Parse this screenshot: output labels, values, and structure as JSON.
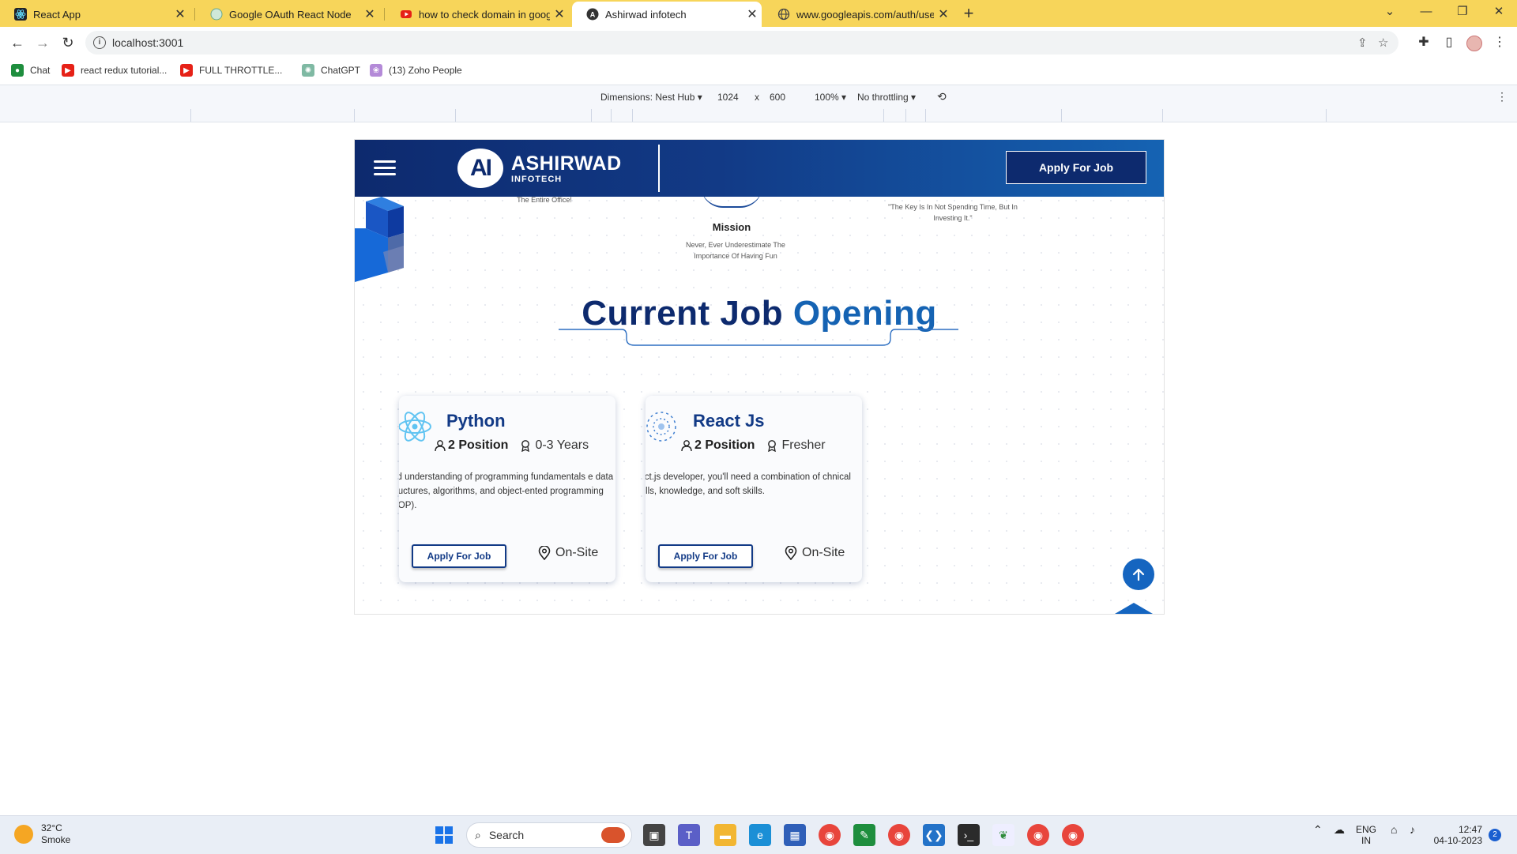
{
  "browser": {
    "tabs": [
      {
        "title": "React App",
        "icon": "react-icon"
      },
      {
        "title": "Google OAuth React Node",
        "icon": "globe-icon"
      },
      {
        "title": "how to check domain in google",
        "icon": "youtube-icon"
      },
      {
        "title": "Ashirwad infotech",
        "icon": "ai-logo-icon"
      },
      {
        "title": "www.googleapis.com/auth/user",
        "icon": "globe-icon"
      }
    ],
    "url": "localhost:3001",
    "bookmarks": [
      {
        "label": "Chat",
        "icon": "google-chat-icon"
      },
      {
        "label": "react redux tutorial...",
        "icon": "youtube-icon"
      },
      {
        "label": "FULL THROTTLE...",
        "icon": "youtube-icon"
      },
      {
        "label": "ChatGPT",
        "icon": "chatgpt-icon"
      },
      {
        "label": "(13) Zoho People",
        "icon": "zoho-icon"
      }
    ]
  },
  "devtools": {
    "dimensions_label": "Dimensions: Nest Hub",
    "width": "1024",
    "times": "x",
    "height": "600",
    "zoom": "100%",
    "throttling": "No throttling"
  },
  "site": {
    "logo_mark": "AI",
    "logo_main": "ASHIRWAD",
    "logo_sub": "INFOTECH",
    "header_apply": "Apply For Job",
    "caption_left": "The Entire Office!",
    "caption_right": "\"The Key Is In Not Spending Time, But In Investing It.\"",
    "mission_title": "Mission",
    "mission_text": "Never, Ever Underestimate The Importance Of Having Fun",
    "section_title_part1": "Current Job",
    "section_title_part2": "Opening"
  },
  "jobs": [
    {
      "title": "Python",
      "positions": "2 Position",
      "experience": "0-3 Years",
      "description": "olid understanding of programming fundamentals e data structures, algorithms, and object-ented programming (OOP).",
      "apply": "Apply For Job",
      "location": "On-Site"
    },
    {
      "title": "React Js",
      "positions": "2 Position",
      "experience": "Fresher",
      "description": "eact.js developer, you'll need a combination of chnical skills, knowledge, and soft skills.",
      "apply": "Apply For Job",
      "location": "On-Site"
    }
  ],
  "taskbar": {
    "temperature": "32°C",
    "weather": "Smoke",
    "search": "Search",
    "lang1": "ENG",
    "lang2": "IN",
    "time": "12:47",
    "date": "04-10-2023",
    "notifications": "2"
  },
  "colors": {
    "tabbar": "#f7d55a",
    "brand_dark": "#0d2a6e",
    "brand_blue": "#1563b3"
  }
}
